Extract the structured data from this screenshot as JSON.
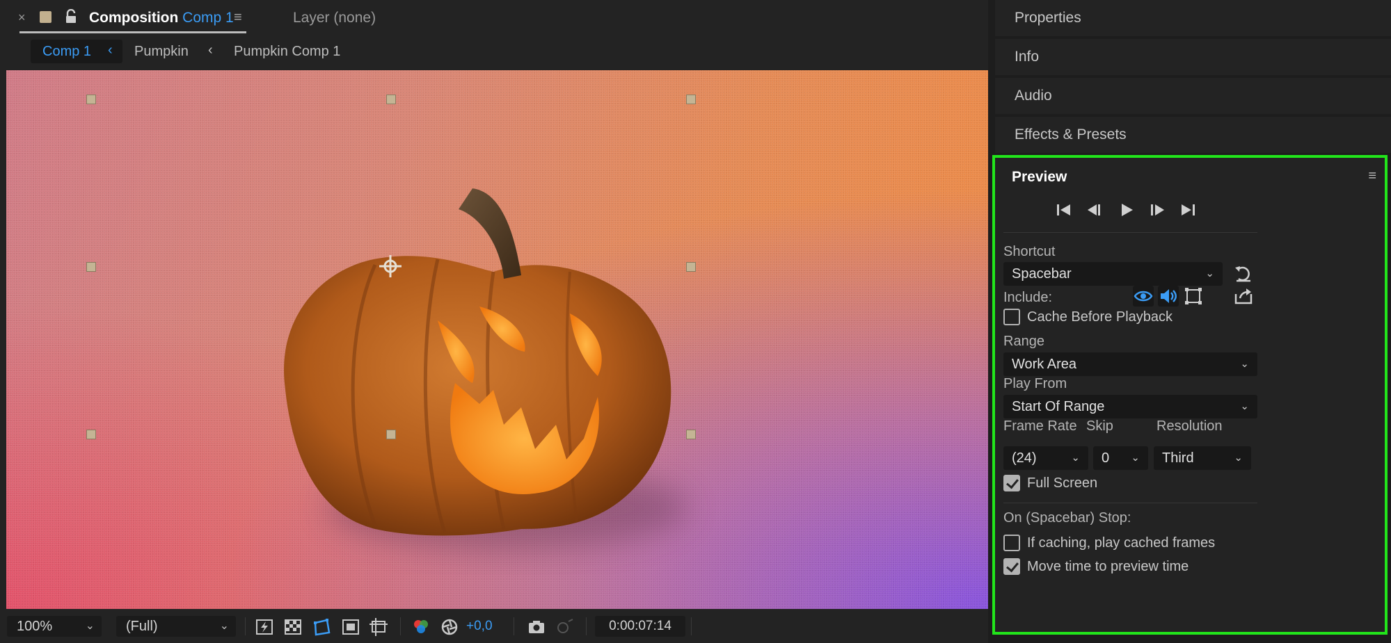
{
  "composition_tab": {
    "close_glyph": "×",
    "prefix": "Composition",
    "comp_name": "Comp 1",
    "layer_label": "Layer (none)",
    "swatch_color": "#c2b08e"
  },
  "breadcrumbs": [
    {
      "label": "Comp 1",
      "active": true
    },
    {
      "label": "Pumpkin",
      "active": false
    },
    {
      "label": "Pumpkin Comp 1",
      "active": false
    }
  ],
  "breadcrumb_separator": "‹",
  "viewer": {
    "content": "pumpkin-image",
    "background_colors": [
      "#d07a86",
      "#ef8a42",
      "#8a5ae6"
    ]
  },
  "bottom_bar": {
    "zoom": "100%",
    "resolution": "(Full)",
    "exposure": "+0,0",
    "timecode": "0:00:07:14"
  },
  "side_sections": [
    "Properties",
    "Info",
    "Audio",
    "Effects & Presets"
  ],
  "preview": {
    "title": "Preview",
    "menu_glyph": "≡",
    "shortcut_label": "Shortcut",
    "shortcut_value": "Spacebar",
    "include_label": "Include:",
    "cache_before_playback": {
      "label": "Cache Before Playback",
      "checked": false
    },
    "range_label": "Range",
    "range_value": "Work Area",
    "play_from_label": "Play From",
    "play_from_value": "Start Of Range",
    "frame_rate_label": "Frame Rate",
    "frame_rate_value": "(24)",
    "skip_label": "Skip",
    "skip_value": "0",
    "resolution_label": "Resolution",
    "resolution_value": "Third",
    "full_screen": {
      "label": "Full Screen",
      "checked": true
    },
    "stop_label": "On (Spacebar) Stop:",
    "if_caching": {
      "label": "If caching, play cached frames",
      "checked": false
    },
    "move_time": {
      "label": "Move time to preview time",
      "checked": true
    },
    "highlight_color": "#22e51b"
  },
  "colors": {
    "accent_blue": "#3b9cf5",
    "panel_bg": "#232323"
  }
}
